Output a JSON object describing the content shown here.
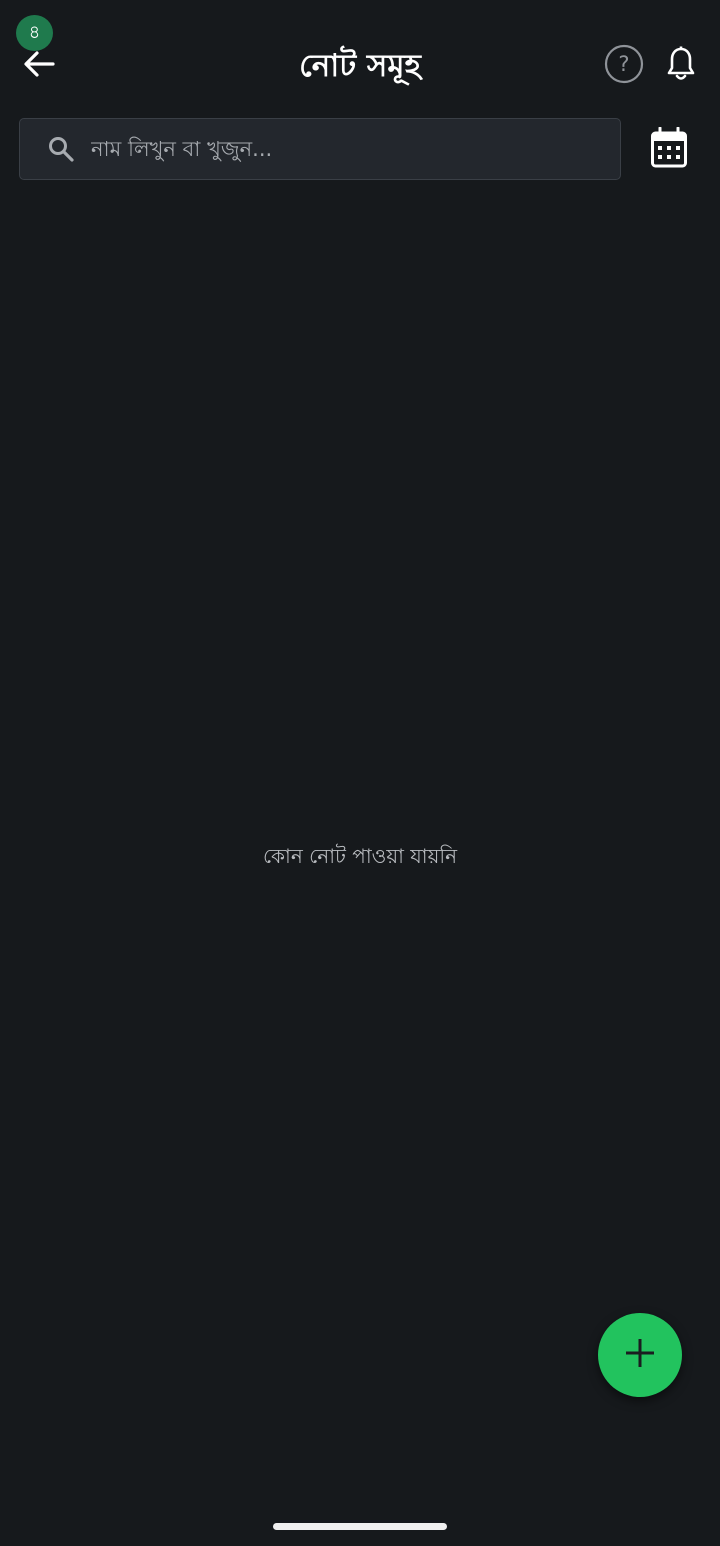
{
  "status": {
    "badge_count": "৪"
  },
  "header": {
    "title": "নোট সমূহ",
    "back_icon": "arrow-left-icon",
    "help_icon": "help-circle-icon",
    "bell_icon": "bell-icon"
  },
  "search": {
    "placeholder": "নাম লিখুন বা খুজুন...",
    "value": "",
    "icon": "search-icon"
  },
  "calendar": {
    "icon": "calendar-icon"
  },
  "content": {
    "empty_message": "কোন নোট পাওয়া যায়নি"
  },
  "fab": {
    "icon": "plus-icon",
    "color": "#22c35e"
  },
  "colors": {
    "background": "#16191c",
    "search_bg": "#23272d",
    "badge": "#1f7a4d"
  }
}
